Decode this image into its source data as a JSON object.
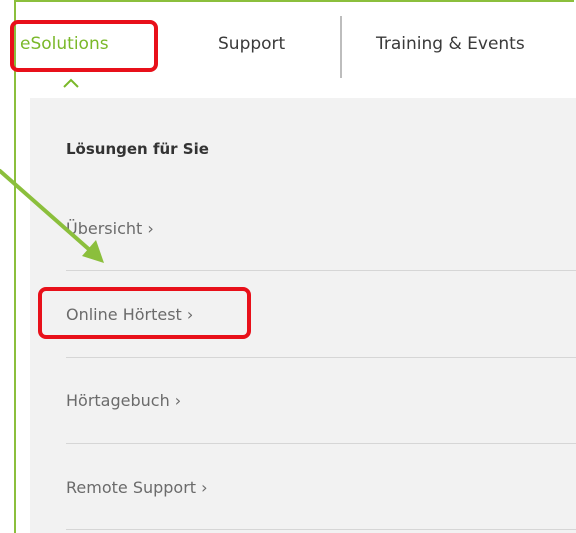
{
  "nav": {
    "items": [
      {
        "label": "eSolutions",
        "active": true
      },
      {
        "label": "Support"
      },
      {
        "label": "Training & Events"
      }
    ],
    "active_caret_icon": "chevron-up-icon"
  },
  "dropdown": {
    "title": "Lösungen für Sie",
    "items": [
      {
        "label": "Übersicht ›"
      },
      {
        "label": "Online Hörtest ›"
      },
      {
        "label": "Hörtagebuch ›"
      },
      {
        "label": "Remote Support ›"
      }
    ]
  },
  "annotations": {
    "highlights": [
      "eSolutions",
      "Online Hörtest ›"
    ],
    "arrow_icon": "arrow-pointer-icon"
  },
  "colors": {
    "accent_green": "#7ab829",
    "frame_green": "#8bbf3c",
    "highlight_red": "#e8101a",
    "panel_bg": "#f2f2f2",
    "text_gray": "#6b6b6b"
  }
}
